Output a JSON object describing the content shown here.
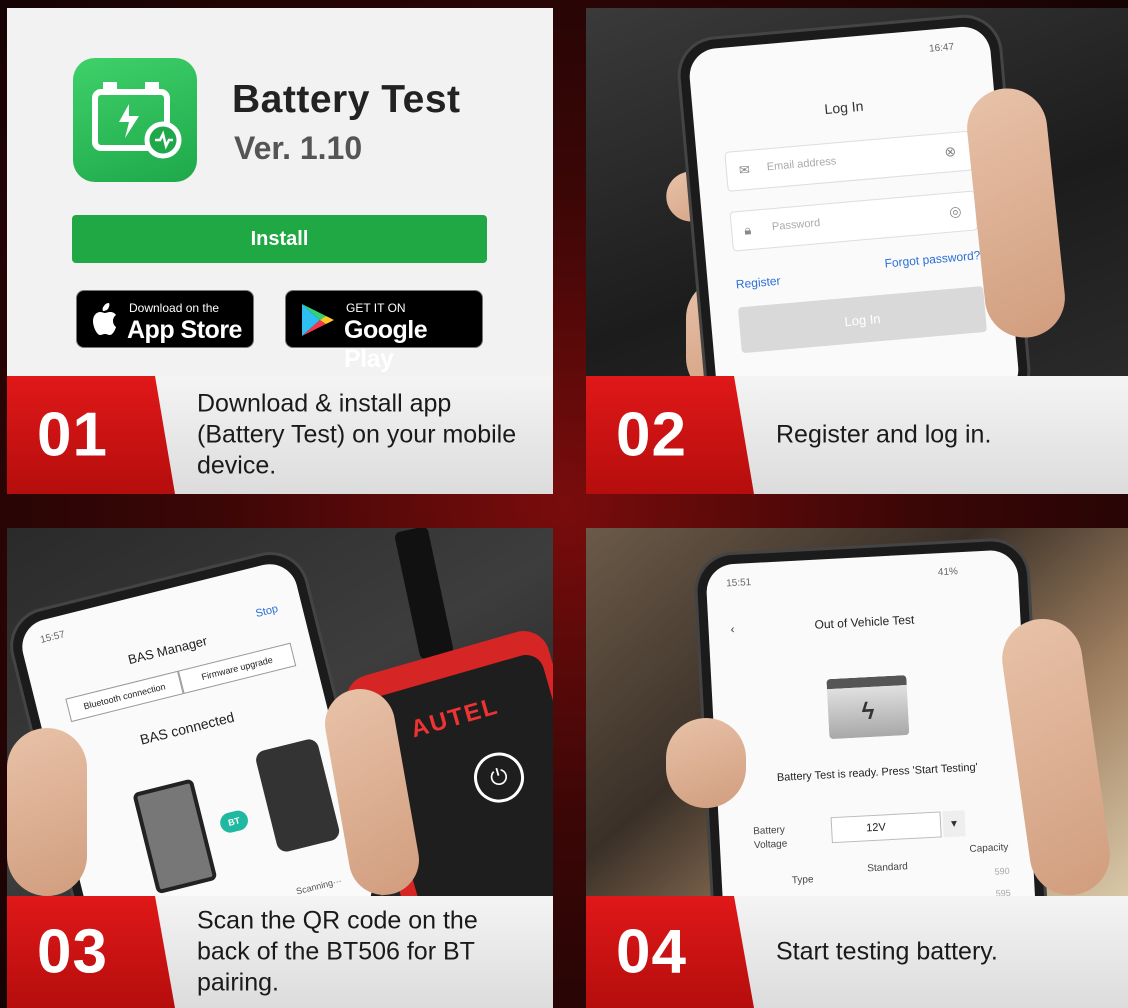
{
  "step1": {
    "number": "01",
    "text": "Download & install app (Battery Test) on your mobile device.",
    "app_title": "Battery Test",
    "app_version": "Ver. 1.10",
    "install_label": "Install",
    "appstore_small": "Download on the",
    "appstore_big": "App Store",
    "googleplay_small": "GET IT ON",
    "googleplay_big": "Google Play"
  },
  "step2": {
    "number": "02",
    "text": "Register and log in.",
    "status_time": "16:47",
    "screen_title": "Log In",
    "email_placeholder": "Email address",
    "password_placeholder": "Password",
    "forgot_label": "Forgot password?",
    "register_label": "Register",
    "login_button": "Log In"
  },
  "step3": {
    "number": "03",
    "text": "Scan the QR code on the back of the BT506 for BT pairing.",
    "status_time": "15:57",
    "screen_title": "BAS Manager",
    "stop_label": "Stop",
    "tab_bluetooth": "Bluetooth connection",
    "tab_firmware": "Firmware upgrade",
    "connected_text": "BAS connected",
    "bt_label": "BT",
    "scanning_text": "Scanning···",
    "device_logo": "AUTEL"
  },
  "step4": {
    "number": "04",
    "text": "Start testing battery.",
    "status_time": "15:51",
    "battery_pct": "41%",
    "screen_title": "Out of Vehicle Test",
    "ready_text": "Battery Test is ready. Press 'Start Testing'",
    "voltage_label": "Battery Voltage",
    "voltage_value": "12V",
    "col_type": "Type",
    "col_standard": "Standard",
    "col_capacity": "Capacity",
    "capacity_values": [
      "590",
      "595"
    ]
  },
  "colors": {
    "accent_red": "#d81515",
    "install_green": "#1fa843",
    "link_blue": "#2b6fd6"
  }
}
